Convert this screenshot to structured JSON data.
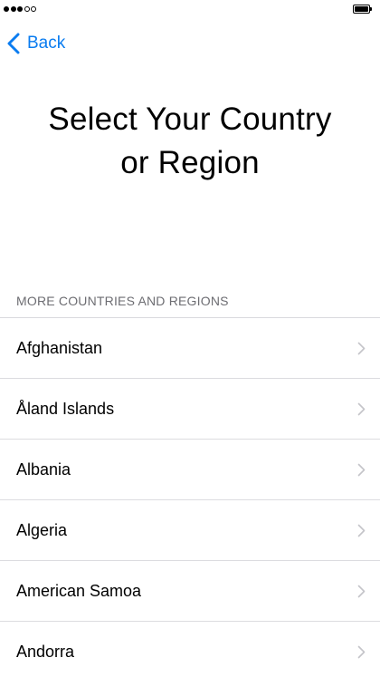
{
  "status_bar": {
    "signal_bars_filled": 3,
    "signal_bars_total": 5,
    "battery_level": 1.0
  },
  "nav": {
    "back_label": "Back",
    "back_icon": "chevron-left-icon",
    "accent_color": "#0a7cf0"
  },
  "title": {
    "line1": "Select Your Country",
    "line2": "or Region"
  },
  "section": {
    "header": "MORE COUNTRIES AND REGIONS",
    "items": [
      {
        "label": "Afghanistan"
      },
      {
        "label": "Åland Islands"
      },
      {
        "label": "Albania"
      },
      {
        "label": "Algeria"
      },
      {
        "label": "American Samoa"
      },
      {
        "label": "Andorra"
      }
    ],
    "item_icon": "chevron-right-icon"
  }
}
